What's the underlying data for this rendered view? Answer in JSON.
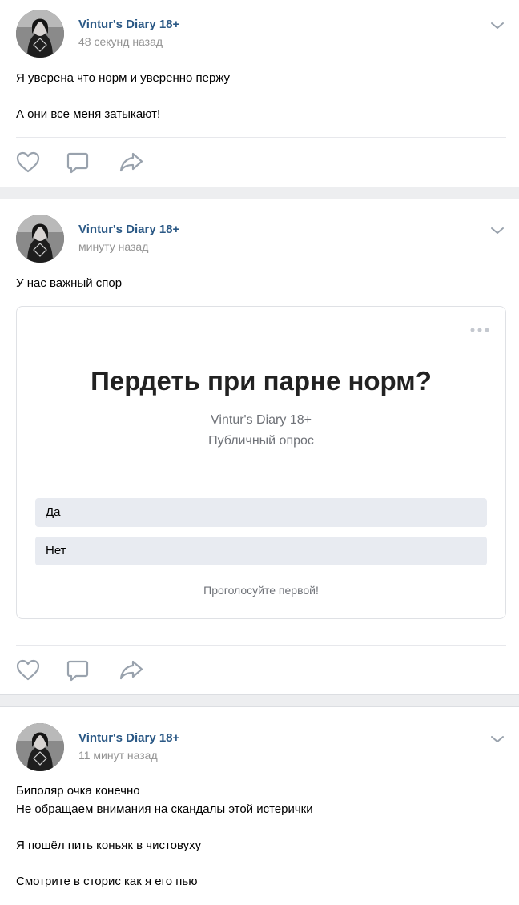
{
  "posts": [
    {
      "author": "Vintur's Diary 18+",
      "time": "48 секунд назад",
      "text": {
        "line1": "Я уверена что норм и уверенно пержу",
        "line2": "А они все меня затыкают!"
      }
    },
    {
      "author": "Vintur's Diary 18+",
      "time": "минуту назад",
      "text": {
        "line1": "У нас важный спор"
      },
      "poll": {
        "question": "Пердеть при парне норм?",
        "owner": "Vintur's Diary 18+",
        "type": "Публичный опрос",
        "options": [
          "Да",
          "Нет"
        ],
        "footer": "Проголосуйте первой!"
      }
    },
    {
      "author": "Vintur's Diary 18+",
      "time": "11 минут назад",
      "text": {
        "line1": "Биполяр очка конечно",
        "line2": "Не обращаем внимания на скандалы этой истерички",
        "line3": "Я пошёл пить коньяк в чистовуху",
        "line4": "Смотрите в сторис как я его пью"
      }
    }
  ],
  "icons": {
    "like": "heart-icon",
    "comment": "comment-icon",
    "share": "share-icon",
    "more": "chevron-down-icon",
    "poll_menu": "more-dots-icon"
  },
  "colors": {
    "author": "#2a5885",
    "meta": "#939393",
    "icon": "#99a2ad",
    "poll_option_bg": "#e8ebf1",
    "separator": "#edeef0"
  }
}
